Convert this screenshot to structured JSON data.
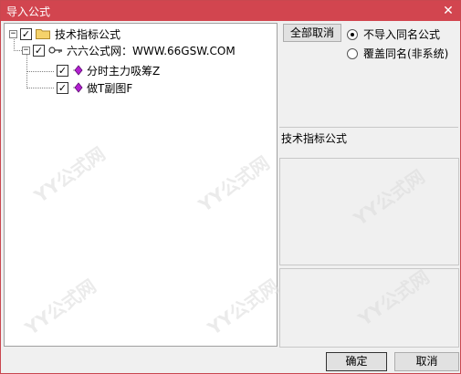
{
  "window": {
    "title": "导入公式",
    "close_glyph": "✕"
  },
  "tree": {
    "root": {
      "label": "技术指标公式",
      "expander": "−",
      "checked": true
    },
    "group": {
      "label": "六六公式网：WWW.66GSW.COM",
      "expander": "−",
      "checked": true,
      "icon": "key-icon"
    },
    "items": [
      {
        "label": "分时主力吸筹Z",
        "checked": true,
        "icon": "formula-gem-icon"
      },
      {
        "label": "做T副图F",
        "checked": true,
        "icon": "formula-gem-icon"
      }
    ]
  },
  "controls": {
    "deselect_all": "全部取消",
    "radio_options": [
      {
        "label": "不导入同名公式",
        "checked": true
      },
      {
        "label": "覆盖同名(非系统)",
        "checked": false
      }
    ],
    "category_label": "技术指标公式",
    "ok": "确定",
    "cancel": "取消"
  },
  "watermark_text": "YY公式网",
  "colors": {
    "titlebar": "#d2454f",
    "gem": "#b31fd1",
    "folder": "#f5d26b"
  }
}
